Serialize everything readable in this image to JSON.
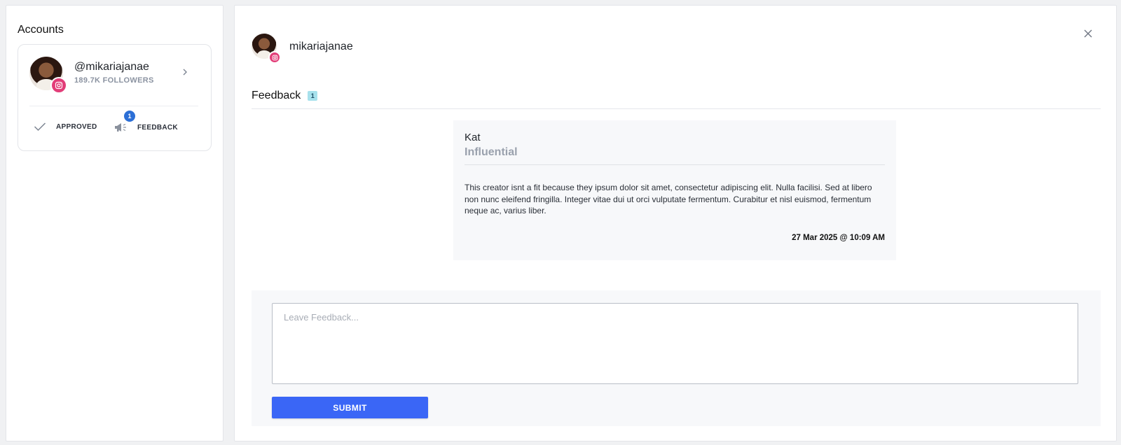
{
  "left_panel": {
    "title": "Accounts",
    "account": {
      "handle": "@mikariajanae",
      "followers": "189.7K FOLLOWERS",
      "platform_icon": "instagram-icon",
      "statuses": [
        {
          "label": "APPROVED",
          "icon": "check-icon"
        },
        {
          "label": "FEEDBACK",
          "icon": "megaphone-icon",
          "count": "1"
        }
      ]
    }
  },
  "right_panel": {
    "header": {
      "name": "mikariajanae",
      "platform_icon": "instagram-icon"
    },
    "feedback_section": {
      "title": "Feedback",
      "count": "1",
      "entries": [
        {
          "author": "Kat",
          "organization": "Influential",
          "body": "This creator isnt a fit because they ipsum dolor sit amet, consectetur adipiscing elit. Nulla facilisi. Sed at libero non nunc eleifend fringilla. Integer vitae dui ut orci vulputate fermentum. Curabitur et nisl euismod, fermentum neque ac, varius liber.",
          "timestamp": "27 Mar 2025 @ 10:09 AM"
        }
      ]
    },
    "compose": {
      "placeholder": "Leave Feedback...",
      "submit_label": "SUBMIT"
    }
  },
  "colors": {
    "accent": "#3a66f6",
    "instagram": "#e23d78",
    "badge_blue": "#2c6fd6",
    "pill_cyan": "#a7e1ec"
  }
}
